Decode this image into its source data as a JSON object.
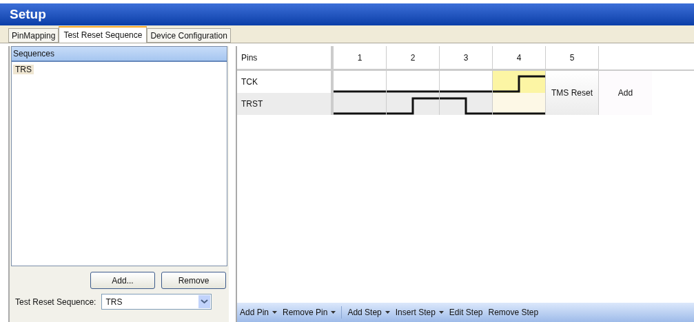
{
  "window": {
    "title": "Setup"
  },
  "tabs": [
    {
      "label": "PinMapping",
      "selected": false
    },
    {
      "label": "Test Reset Sequence",
      "selected": true
    },
    {
      "label": "Device Configuration",
      "selected": false
    }
  ],
  "sequences": {
    "header": "Sequences",
    "items": [
      {
        "label": "TRS",
        "selected": true
      }
    ],
    "buttons": [
      "Add...",
      "Remove"
    ],
    "field_label": "Test Reset Sequence:",
    "field_value": "TRS"
  },
  "grid": {
    "pins_header": "Pins",
    "steps": [
      {
        "label": "1",
        "kind": "signal",
        "selected": false
      },
      {
        "label": "2",
        "kind": "signal",
        "selected": false
      },
      {
        "label": "3",
        "kind": "signal",
        "selected": false
      },
      {
        "label": "4",
        "kind": "signal",
        "selected": true
      },
      {
        "label": "5",
        "kind": "action",
        "text": "TMS Reset"
      }
    ],
    "pins": [
      {
        "name": "TCK",
        "waves": [
          {
            "kind": "low"
          },
          {
            "kind": "low"
          },
          {
            "kind": "low"
          },
          {
            "kind": "rise"
          }
        ]
      },
      {
        "name": "TRST",
        "waves": [
          {
            "kind": "low"
          },
          {
            "kind": "rise"
          },
          {
            "kind": "fall"
          },
          {
            "kind": "low"
          }
        ]
      }
    ],
    "add_label": "Add"
  },
  "toolbar": [
    {
      "kind": "button",
      "label": "Add Pin",
      "dropdown": true
    },
    {
      "kind": "button",
      "label": "Remove Pin",
      "dropdown": true
    },
    {
      "kind": "separator"
    },
    {
      "kind": "button",
      "label": "Add Step",
      "dropdown": true
    },
    {
      "kind": "button",
      "label": "Insert Step",
      "dropdown": true
    },
    {
      "kind": "button",
      "label": "Edit Step",
      "dropdown": false
    },
    {
      "kind": "button",
      "label": "Remove Step",
      "dropdown": false
    }
  ]
}
